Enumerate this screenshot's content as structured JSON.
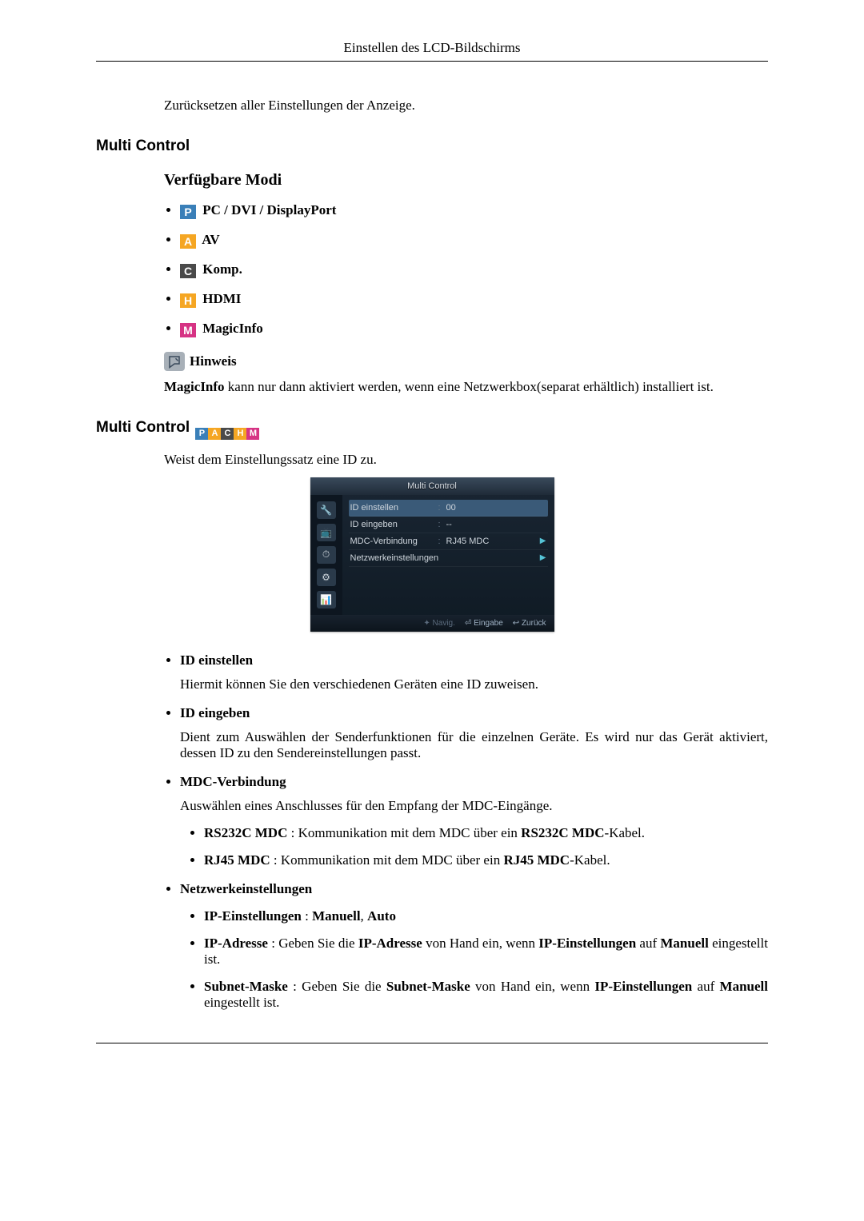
{
  "header": {
    "title": "Einstellen des LCD-Bildschirms"
  },
  "intro": "Zurücksetzen aller Einstellungen der Anzeige.",
  "section1": {
    "title": "Multi Control",
    "modes_heading": "Verfügbare Modi",
    "modes": [
      {
        "icon": "P",
        "css": "icon-p",
        "label": " PC / DVI / DisplayPort"
      },
      {
        "icon": "A",
        "css": "icon-a",
        "label": " AV"
      },
      {
        "icon": "C",
        "css": "icon-c",
        "label": " Komp."
      },
      {
        "icon": "H",
        "css": "icon-h",
        "label": " HDMI"
      },
      {
        "icon": "M",
        "css": "icon-m",
        "label": " MagicInfo"
      }
    ],
    "hint_label": "Hinweis",
    "hint_prefix": "MagicInfo",
    "hint_rest": " kann nur dann aktiviert werden, wenn eine Netzwerkbox(separat erhältlich) installiert ist."
  },
  "section2": {
    "title": "Multi Control",
    "lead": "Weist dem Einstellungssatz eine ID zu.",
    "osd": {
      "title": "Multi Control",
      "rows": [
        {
          "label": "ID einstellen",
          "value": "00",
          "selected": true,
          "arrow": false
        },
        {
          "label": "ID eingeben",
          "value": "--",
          "selected": false,
          "arrow": false
        },
        {
          "label": "MDC-Verbindung",
          "value": "RJ45 MDC",
          "selected": false,
          "arrow": true
        },
        {
          "label": "Netzwerkeinstellungen",
          "value": "",
          "selected": false,
          "arrow": true
        }
      ],
      "footer": {
        "nav": "Navig.",
        "enter": "Eingabe",
        "back": "Zurück"
      }
    },
    "defs": [
      {
        "title": "ID einstellen",
        "body": "Hiermit können Sie den verschiedenen Geräten eine ID zuweisen."
      },
      {
        "title": "ID eingeben",
        "body": "Dient zum Auswählen der Senderfunktionen für die einzelnen Geräte. Es wird nur das Gerät aktiviert, dessen ID zu den Sendereinstellungen passt."
      },
      {
        "title": "MDC-Verbindung",
        "body": "Auswählen eines Anschlusses für den Empfang der MDC-Eingänge.",
        "sub": [
          {
            "b1": "RS232C MDC",
            "mid": " : Kommunikation mit dem MDC über ein ",
            "b2": "RS232C MDC",
            "tail": "-Kabel."
          },
          {
            "b1": "RJ45 MDC",
            "mid": " : Kommunikation mit dem MDC über ein ",
            "b2": "RJ45 MDC",
            "tail": "-Kabel."
          }
        ]
      },
      {
        "title": "Netzwerkeinstellungen",
        "sub2": [
          {
            "b1": "IP-Einstellungen",
            "mid": " : ",
            "b2": "Manuell",
            "sep": ", ",
            "b3": "Auto"
          },
          {
            "b1": "IP-Adresse",
            "mid": " : Geben Sie die ",
            "b2": "IP-Adresse",
            "mid2": " von Hand ein, wenn ",
            "b3": "IP-Einstellungen",
            "mid3": " auf ",
            "b4": "Manuell",
            "tail": " eingestellt ist."
          },
          {
            "b1": "Subnet-Maske",
            "mid": " : Geben Sie die ",
            "b2": "Subnet-Maske",
            "mid2": " von Hand ein, wenn ",
            "b3": "IP-Einstellungen",
            "mid3": " auf ",
            "b4": "Manuell",
            "tail": " eingestellt ist."
          }
        ]
      }
    ]
  }
}
